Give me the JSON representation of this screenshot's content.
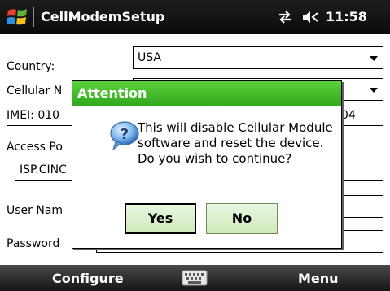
{
  "titlebar": {
    "app_title": "CellModemSetup",
    "clock": "11:58",
    "icons": [
      "windows-start-icon",
      "connectivity-icon",
      "volume-icon"
    ]
  },
  "form": {
    "country_label": "Country:",
    "country_value": "USA",
    "cellular_label": "Cellular N",
    "cellular_value": "",
    "imei_label": "IMEI: 010",
    "imei_tail": "204",
    "access_label": "Access Po",
    "access_value": "ISP.CINC",
    "username_label": "User Nam",
    "username_value": "",
    "password_label": "Password",
    "password_value": ""
  },
  "dialog": {
    "title": "Attention",
    "icon": "question-icon",
    "message": "This will disable Cellular Module software and reset the device.  Do you wish to continue?",
    "yes_label": "Yes",
    "no_label": "No"
  },
  "softkeys": {
    "left": "Configure",
    "center_icon": "keyboard-icon",
    "right": "Menu"
  },
  "colors": {
    "titlebar_bg": "#111111",
    "dialog_header": "#3db82a",
    "button_bg": "#dff0d2",
    "softbar_bg": "#2a2a2a"
  }
}
